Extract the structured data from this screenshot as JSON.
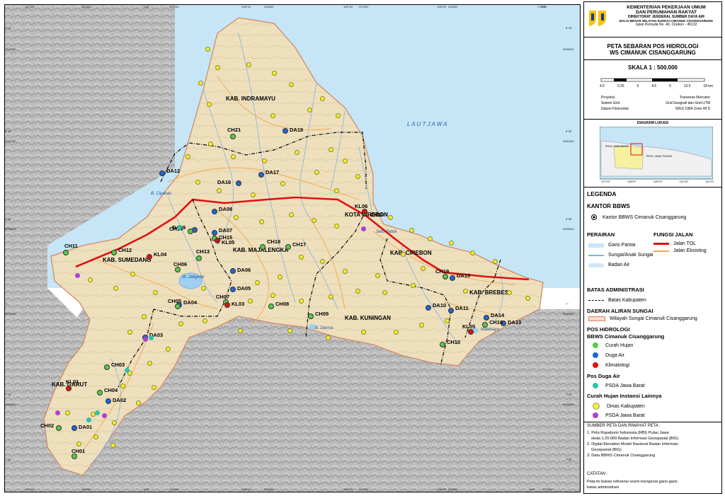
{
  "agency": {
    "line1": "KEMENTERIAN PEKERJAAN UMUM",
    "line2": "DAN PERUMAHAN RAKYAT",
    "line3": "DIREKTORAT JENDERAL SUMBER DAYA AIR",
    "line4": "BALAI BESAR WILAYAH SUNGAI CIMANUK CISANGGARUNG",
    "line5": "Jalan Pemuda No. 40, Cirebon - 45132"
  },
  "title": {
    "line1": "PETA SEBARAN POS HIDROLOGI",
    "line2": "WS CIMANUK CISANGGARUNG"
  },
  "scale": {
    "label": "SKALA  1 : 500.000",
    "ticks": [
      "4.5",
      "2.25",
      "0",
      "4.5",
      "9",
      "13.5",
      "18 km"
    ]
  },
  "projection": [
    {
      "k": "Proyeksi",
      "v": "Tranverse Mercator"
    },
    {
      "k": "Sistem Grid",
      "v": "Grid Geografi dan Grid UTM"
    },
    {
      "k": "Datum Horizontal",
      "v": "WGS 1984 Zone 49 S"
    }
  ],
  "location": {
    "title": "DIAGRAM LOKASI",
    "labels": [
      "PROV. JAWA BARAT",
      "PROV. JAWA TENGAH"
    ],
    "lon_ticks": [
      "107°0'0\"",
      "108°0'0\"",
      "109°0'0\"",
      "110°0'0\"",
      "111°0'0\""
    ]
  },
  "legend": {
    "title": "LEGENDA",
    "office_head": "KANTOR BBWS",
    "office": "Kantor BBWS Cimanuk Cisanggarung",
    "waters_head": "PERAIRAN",
    "coast": "Garis Pantai",
    "river": "Sungai/Anak Sungai",
    "water_body": "Badan Air",
    "road_head": "FUNGSI JALAN",
    "toll": "Jalan TOL",
    "road": "Jalan Eksisting",
    "admin_head": "BATAS ADMINISTRASI",
    "kab": "Batas Kabupaten",
    "das_head": "DAERAH ALIRAN SUNGAI",
    "das": "Wilayah Sungai Cimanuk Cisanggarung",
    "pos_head": "POS HIDROLOGI",
    "bbws_head": "BBWS Cimanuk Cisanggarung",
    "rain": "Curah Hujan",
    "duga": "Duga Air",
    "klim": "Klimatologi",
    "posduga_head": "Pos Duga Air",
    "psda": "PSDA Jawa Barat",
    "other_head": "Curah Hujan Instansi Lainnya",
    "dinas": "Dinas Kabupaten",
    "psda2": "PSDA Jawa Barat"
  },
  "sources": {
    "head": "SUMBER PETA DAN RIWAYAT PETA :",
    "items": [
      "1. Peta Rupabumi Indonesia (RBI) Pulau Jawa",
      "    skala 1:25.000 Badan Informasi Geospasial (BIG)",
      "2. Digital Elevation Model Nasional Badan Informasi",
      "    Geospasial (BIG)",
      "3. Data BBWS Cimanuk Cisanggarung"
    ]
  },
  "notes": {
    "head": "CATATAN :",
    "items": [
      "Peta ini bukan referensi resmi mengenai garis-garis",
      "batas administrasi"
    ]
  },
  "map": {
    "regions": [
      "KAB. INDRAMAYU",
      "KOTA CIREBON",
      "KAB. CIREBON",
      "KAB. MAJALENGKA",
      "KAB. SUMEDANG",
      "KAB. KUNINGAN",
      "KAB. BREBES",
      "KAB. GARUT"
    ],
    "sea": "L A U T  J A W A",
    "water_labels": [
      "B. Cipanas",
      "W. Jatigede",
      "B. Darma",
      "Malahayu",
      "Setu Patok"
    ],
    "top_coords": [
      "107°45'",
      "152000",
      "108°",
      "177000",
      "108°15'",
      "202000",
      "108°30'",
      "227000",
      "108°45'",
      "252000",
      "109°",
      "277000"
    ],
    "bottom_coords": [
      "107°45'",
      "152000",
      "108°",
      "177000",
      "108°15'",
      "202000",
      "108°30'",
      "227000",
      "108°45'",
      "252000",
      "109°",
      "277000"
    ],
    "left_coords": [
      "6°15'",
      "9306000",
      "6°30'",
      "9281000",
      "6°45'",
      "9256000",
      "7°",
      "9231000",
      "7°15'",
      "9206000",
      "7°30'"
    ],
    "right_coords": [
      "6°15'",
      "9306000",
      "6°30'",
      "9281000",
      "6°45'",
      "9256000",
      "7°",
      "9231000",
      "7°15'",
      "9206000",
      "7°30'"
    ],
    "stations": [
      {
        "id": "DA12",
        "type": "duga"
      },
      {
        "id": "DA18",
        "type": "duga"
      },
      {
        "id": "DA17",
        "type": "duga"
      },
      {
        "id": "DA16",
        "type": "duga"
      },
      {
        "id": "DA08",
        "type": "duga"
      },
      {
        "id": "DA09",
        "type": "duga"
      },
      {
        "id": "DA07",
        "type": "duga"
      },
      {
        "id": "DA06",
        "type": "duga"
      },
      {
        "id": "DA05",
        "type": "duga"
      },
      {
        "id": "DA04",
        "type": "duga"
      },
      {
        "id": "DA03",
        "type": "duga"
      },
      {
        "id": "DA02",
        "type": "duga"
      },
      {
        "id": "DA01",
        "type": "duga"
      },
      {
        "id": "DA10",
        "type": "duga"
      },
      {
        "id": "DA11",
        "type": "duga"
      },
      {
        "id": "DA13",
        "type": "duga"
      },
      {
        "id": "DA14",
        "type": "duga"
      },
      {
        "id": "DA15",
        "type": "duga"
      },
      {
        "id": "CH21",
        "type": "rain"
      },
      {
        "id": "CH20",
        "type": "rain"
      },
      {
        "id": "CH18",
        "type": "rain"
      },
      {
        "id": "CH17",
        "type": "rain"
      },
      {
        "id": "CH14",
        "type": "rain"
      },
      {
        "id": "CH15",
        "type": "rain"
      },
      {
        "id": "CH13",
        "type": "rain"
      },
      {
        "id": "CH12",
        "type": "rain"
      },
      {
        "id": "CH11",
        "type": "rain"
      },
      {
        "id": "CH06",
        "type": "rain"
      },
      {
        "id": "CH05",
        "type": "rain"
      },
      {
        "id": "CH07",
        "type": "rain"
      },
      {
        "id": "CH08",
        "type": "rain"
      },
      {
        "id": "CH09",
        "type": "rain"
      },
      {
        "id": "CH19",
        "type": "rain"
      },
      {
        "id": "CH16",
        "type": "rain"
      },
      {
        "id": "CH10",
        "type": "rain"
      },
      {
        "id": "CH03",
        "type": "rain"
      },
      {
        "id": "CH04",
        "type": "rain"
      },
      {
        "id": "CH02",
        "type": "rain"
      },
      {
        "id": "CH01",
        "type": "rain"
      },
      {
        "id": "KL06",
        "type": "klim"
      },
      {
        "id": "KL05",
        "type": "klim"
      },
      {
        "id": "KL04",
        "type": "klim"
      },
      {
        "id": "KL03",
        "type": "klim"
      },
      {
        "id": "KL01",
        "type": "klim"
      },
      {
        "id": "KL05",
        "type": "klim"
      }
    ]
  },
  "colors": {
    "sea": "#c6e6f7",
    "land": "#eedfbd",
    "land_outline": "#d08a6a",
    "hill": "#b8b8b8",
    "toll": "#e01010",
    "road": "#f3a848",
    "river": "#7cb4e8",
    "boundary": "#000000",
    "rain": "#55cc44",
    "duga": "#1f66d6",
    "klim": "#e01010",
    "psda": "#2fc1a8",
    "dinas": "#f6ef2a",
    "psda_other": "#b040d0"
  }
}
